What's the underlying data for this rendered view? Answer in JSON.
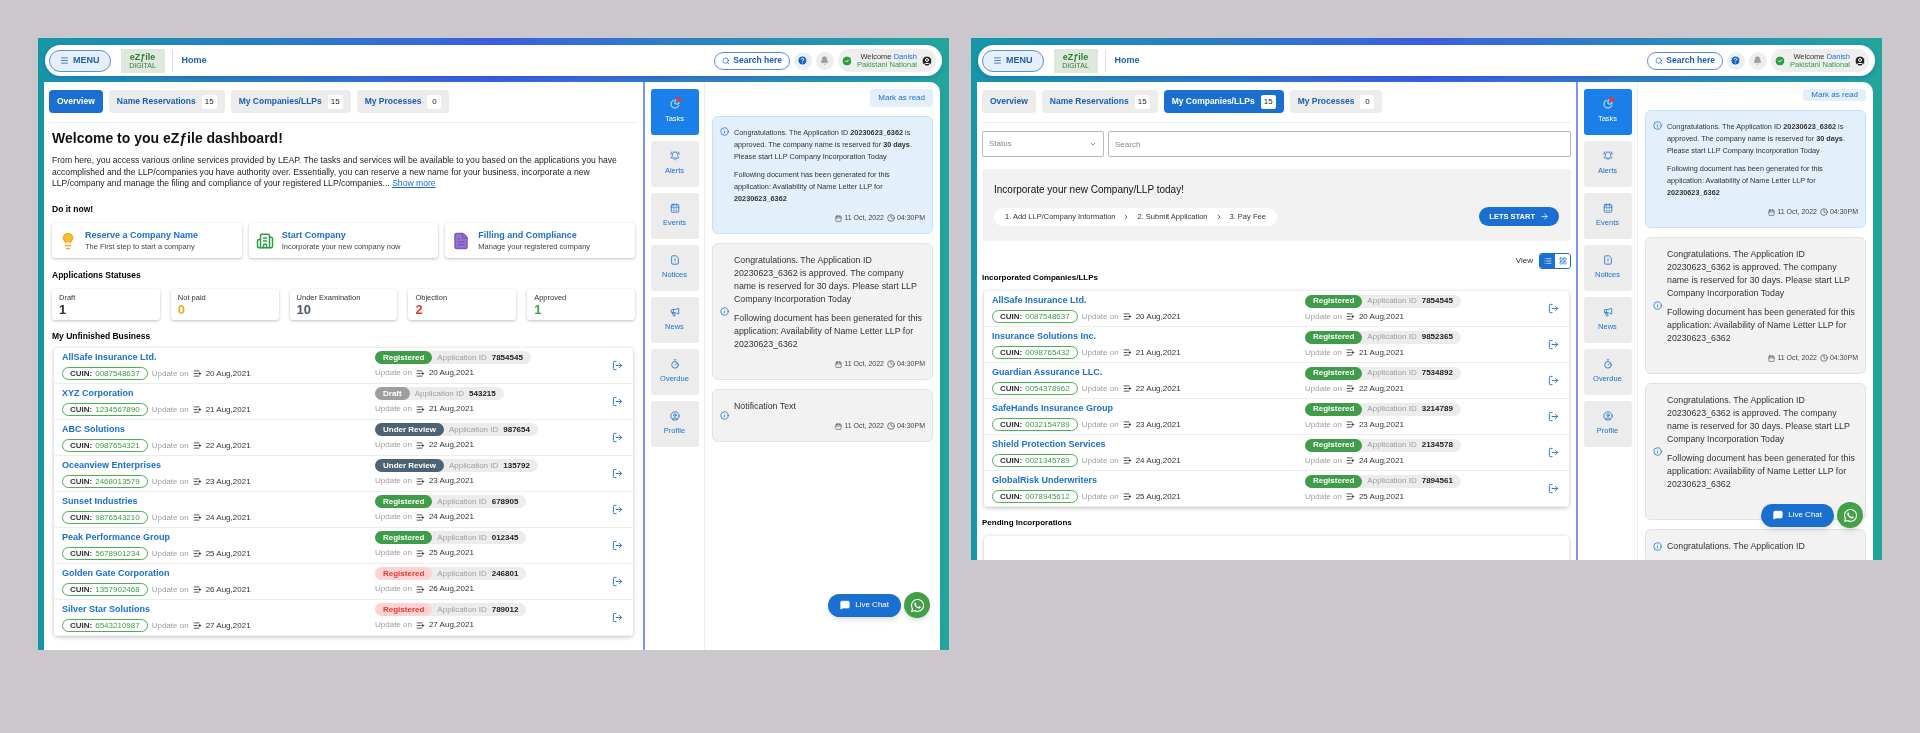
{
  "screens": [
    {
      "kind": "overview",
      "header": {
        "menu": "MENU",
        "logo": "eZƒile",
        "logo_sub": "DIGITAL",
        "home": "Home",
        "search": "Search here",
        "welcome": "Welcome",
        "user": "Danish",
        "role": "Pakistani National"
      },
      "tabs": [
        {
          "label": "Overview",
          "selected": true
        },
        {
          "label": "Name Reservations",
          "count": "15",
          "selected": false
        },
        {
          "label": "My Companies/LLPs",
          "count": "15",
          "selected": false
        },
        {
          "label": "My Processes",
          "count": "0",
          "selected": false
        }
      ],
      "overview": {
        "title": "Welcome to you eZƒile dashboard!",
        "intro": "From here, you access various online services provided by LEAP. The tasks and services will be available to you based on the applications you have accomplished and the LLP/companies you have authority over. Essentially, you can reserve a new name for your business, incorporate a new LLP/company and manage the filing and compliance of your registered LLP/companies...",
        "show_more": "Show more",
        "do_now_heading": "Do it now!",
        "actions": [
          {
            "title": "Reserve a Company Name",
            "subtitle": "The First step to start a company"
          },
          {
            "title": "Start Company",
            "subtitle": "Incorporate your new company now"
          },
          {
            "title": "Filling and Compliance",
            "subtitle": "Manage your registered company"
          }
        ],
        "statuses_heading": "Applications Statuses",
        "statuses": [
          {
            "label": "Draft",
            "value": "1",
            "color": "#333333"
          },
          {
            "label": "Not paid",
            "value": "0",
            "color": "#f5a623"
          },
          {
            "label": "Under Examination",
            "value": "10",
            "color": "#4a5a6a"
          },
          {
            "label": "Objection",
            "value": "2",
            "color": "#e53935"
          },
          {
            "label": "Approved",
            "value": "1",
            "color": "#43a047"
          }
        ],
        "unfinished_heading": "My Unfinished Business",
        "rows": [
          {
            "name": "AllSafe Insurance Ltd.",
            "cuin_label": "CUIN:",
            "cuin": "0087548637",
            "updated_label": "Update on",
            "updated": "20 Aug,2021",
            "status": {
              "label": "Registered",
              "kind": "success"
            },
            "app_id_label": "Application ID",
            "app_id": "7854545",
            "status_updated_label": "Update on",
            "status_updated": "20 Aug,2021"
          },
          {
            "name": "XYZ Corporation",
            "cuin_label": "CUIN:",
            "cuin": "1234567890",
            "updated_label": "Update on",
            "updated": "21 Aug,2021",
            "status": {
              "label": "Draft",
              "kind": "neutral"
            },
            "app_id_label": "Application ID",
            "app_id": "543215",
            "status_updated_label": "Update on",
            "status_updated": "21 Aug,2021"
          },
          {
            "name": "ABC Solutions",
            "cuin_label": "CUIN:",
            "cuin": "0987654321",
            "updated_label": "Update on",
            "updated": "22 Aug,2021",
            "status": {
              "label": "Under Review",
              "kind": "dark"
            },
            "app_id_label": "Application ID",
            "app_id": "987654",
            "status_updated_label": "Update on",
            "status_updated": "22 Aug,2021"
          },
          {
            "name": "Oceanview Enterprises",
            "cuin_label": "CUIN:",
            "cuin": "2468013579",
            "updated_label": "Update on",
            "updated": "23 Aug,2021",
            "status": {
              "label": "Under Review",
              "kind": "dark"
            },
            "app_id_label": "Application ID",
            "app_id": "135792",
            "status_updated_label": "Update on",
            "status_updated": "23 Aug,2021"
          },
          {
            "name": "Sunset Industries",
            "cuin_label": "CUIN:",
            "cuin": "9876543210",
            "updated_label": "Update on",
            "updated": "24 Aug,2021",
            "status": {
              "label": "Registered",
              "kind": "success"
            },
            "app_id_label": "Application ID",
            "app_id": "678905",
            "status_updated_label": "Update on",
            "status_updated": "24 Aug,2021"
          },
          {
            "name": "Peak Performance Group",
            "cuin_label": "CUIN:",
            "cuin": "5678901234",
            "updated_label": "Update on",
            "updated": "25 Aug,2021",
            "status": {
              "label": "Registered",
              "kind": "success"
            },
            "app_id_label": "Application ID",
            "app_id": "012345",
            "status_updated_label": "Update on",
            "status_updated": "25 Aug,2021"
          },
          {
            "name": "Golden Gate Corporation",
            "cuin_label": "CUIN:",
            "cuin": "1357902468",
            "updated_label": "Update on",
            "updated": "26 Aug,2021",
            "status": {
              "label": "Registered",
              "kind": "danger"
            },
            "app_id_label": "Application ID",
            "app_id": "246801",
            "status_updated_label": "Update on",
            "status_updated": "26 Aug,2021"
          },
          {
            "name": "Silver Star Solutions",
            "cuin_label": "CUIN:",
            "cuin": "6543210987",
            "updated_label": "Update on",
            "updated": "27 Aug,2021",
            "status": {
              "label": "Registered",
              "kind": "danger"
            },
            "app_id_label": "Application ID",
            "app_id": "789012",
            "status_updated_label": "Update on",
            "status_updated": "27 Aug,2021"
          }
        ]
      },
      "side_nav": [
        {
          "label": "Tasks",
          "selected": true
        },
        {
          "label": "Alerts",
          "selected": false
        },
        {
          "label": "Events",
          "selected": false
        },
        {
          "label": "Notices",
          "selected": false
        },
        {
          "label": "News",
          "selected": false
        },
        {
          "label": "Overdue",
          "selected": false
        },
        {
          "label": "Profile",
          "selected": false
        }
      ],
      "mark_read": "Mark as read",
      "notifications": [
        {
          "unread": true,
          "paragraphs": [
            "Congratulations. The Application ID **20230623_6362** is approved. The company name is reserved for **30 days**. Please start LLP Company Incorporation Today",
            "Following document has been generated for this application: Availability of Name Letter LLP for **20230623_6362**"
          ],
          "date": "11 Oct, 2022",
          "time": "04:30PM"
        },
        {
          "unread": false,
          "paragraphs": [
            "Congratulations. The Application ID 20230623_6362 is approved. The company name is reserved for 30 days. Please start LLP Company Incorporation Today",
            "Following document has been generated for this application: Availability of Name Letter LLP for 20230623_6362"
          ],
          "date": "11 Oct, 2022",
          "time": "04:30PM"
        },
        {
          "unread": false,
          "paragraphs": [
            "Notification Text"
          ],
          "date": "11 Oct, 2022",
          "time": "04:30PM"
        }
      ],
      "live_chat": "Live Chat"
    },
    {
      "kind": "companies",
      "header": {
        "menu": "MENU",
        "logo": "eZƒile",
        "logo_sub": "DIGITAL",
        "home": "Home",
        "search": "Search here",
        "welcome": "Welcome",
        "user": "Danish",
        "role": "Pakistani National"
      },
      "tabs": [
        {
          "label": "Overview",
          "selected": false
        },
        {
          "label": "Name Reservations",
          "count": "15",
          "selected": false
        },
        {
          "label": "My Companies/LLPs",
          "count": "15",
          "selected": true
        },
        {
          "label": "My Processes",
          "count": "0",
          "selected": false
        }
      ],
      "companies": {
        "status_placeholder": "Status",
        "search_placeholder": "Search",
        "banner_title": "Incorporate your new Company/LLP today!",
        "steps": [
          "1. Add LLP/Company Information",
          "2. Submit Application",
          "3. Pay Fee"
        ],
        "start_button": "LETS START",
        "view_label": "View",
        "view_modes": [
          {
            "selected": true
          },
          {
            "selected": false
          }
        ],
        "incorporated_heading": "Incorporated Companies/LLPs",
        "rows": [
          {
            "name": "AllSafe Insurance Ltd.",
            "cuin_label": "CUIN:",
            "cuin": "0087548637",
            "updated_label": "Update on",
            "updated": "20 Aug,2021",
            "status": {
              "label": "Registered",
              "kind": "success"
            },
            "app_id_label": "Application ID",
            "app_id": "7854545",
            "status_updated_label": "Update on",
            "status_updated": "20 Aug,2021"
          },
          {
            "name": "Insurance Solutions Inc.",
            "cuin_label": "CUIN:",
            "cuin": "0098765432",
            "updated_label": "Update on",
            "updated": "21 Aug,2021",
            "status": {
              "label": "Registered",
              "kind": "success"
            },
            "app_id_label": "Application ID",
            "app_id": "9852365",
            "status_updated_label": "Update on",
            "status_updated": "21 Aug,2021"
          },
          {
            "name": "Guardian Assurance LLC.",
            "cuin_label": "CUIN:",
            "cuin": "0054378962",
            "updated_label": "Update on",
            "updated": "22 Aug,2021",
            "status": {
              "label": "Registered",
              "kind": "success"
            },
            "app_id_label": "Application ID",
            "app_id": "7534892",
            "status_updated_label": "Update on",
            "status_updated": "22 Aug,2021"
          },
          {
            "name": "SafeHands Insurance Group",
            "cuin_label": "CUIN:",
            "cuin": "0032154789",
            "updated_label": "Update on",
            "updated": "23 Aug,2021",
            "status": {
              "label": "Registered",
              "kind": "success"
            },
            "app_id_label": "Application ID",
            "app_id": "3214789",
            "status_updated_label": "Update on",
            "status_updated": "23 Aug,2021"
          },
          {
            "name": "Shield Protection Services",
            "cuin_label": "CUIN:",
            "cuin": "0021345789",
            "updated_label": "Update on",
            "updated": "24 Aug,2021",
            "status": {
              "label": "Registered",
              "kind": "success"
            },
            "app_id_label": "Application ID",
            "app_id": "2134578",
            "status_updated_label": "Update on",
            "status_updated": "24 Aug,2021"
          },
          {
            "name": "GlobalRisk Underwriters",
            "cuin_label": "CUIN:",
            "cuin": "0078945612",
            "updated_label": "Update on",
            "updated": "25 Aug,2021",
            "status": {
              "label": "Registered",
              "kind": "success"
            },
            "app_id_label": "Application ID",
            "app_id": "7894561",
            "status_updated_label": "Update on",
            "status_updated": "25 Aug,2021"
          }
        ],
        "pending_heading": "Pending Incorporations"
      },
      "side_nav": [
        {
          "label": "Tasks",
          "selected": true
        },
        {
          "label": "Alerts",
          "selected": false
        },
        {
          "label": "Events",
          "selected": false
        },
        {
          "label": "Notices",
          "selected": false
        },
        {
          "label": "News",
          "selected": false
        },
        {
          "label": "Overdue",
          "selected": false
        },
        {
          "label": "Profile",
          "selected": false
        }
      ],
      "mark_read": "Mark as read",
      "notifications": [
        {
          "unread": true,
          "paragraphs": [
            "Congratulations. The Application ID **20230623_6362** is approved. The company name is reserved for **30 days**. Please start LLP Company Incorporation Today",
            "Following document has been generated for this application: Availability of Name Letter LLP for **20230623_6362**"
          ],
          "date": "11 Oct, 2022",
          "time": "04:30PM"
        },
        {
          "unread": false,
          "paragraphs": [
            "Congratulations. The Application ID 20230623_6362 is approved. The company name is reserved for 30 days. Please start LLP Company Incorporation Today",
            "Following document has been generated for this application: Availability of Name Letter LLP for 20230623_6362"
          ],
          "date": "11 Oct, 2022",
          "time": "04:30PM"
        },
        {
          "unread": false,
          "paragraphs": [
            "Congratulations. The Application ID 20230623_6362 is approved. The company name is reserved for 30 days. Please start LLP Company Incorporation Today",
            "Following document has been generated for this application: Availability of Name Letter LLP for 20230623_6362"
          ]
        },
        {
          "unread": false,
          "paragraphs": [
            "Congratulations. The Application ID"
          ]
        }
      ],
      "live_chat": "Live Chat"
    }
  ]
}
